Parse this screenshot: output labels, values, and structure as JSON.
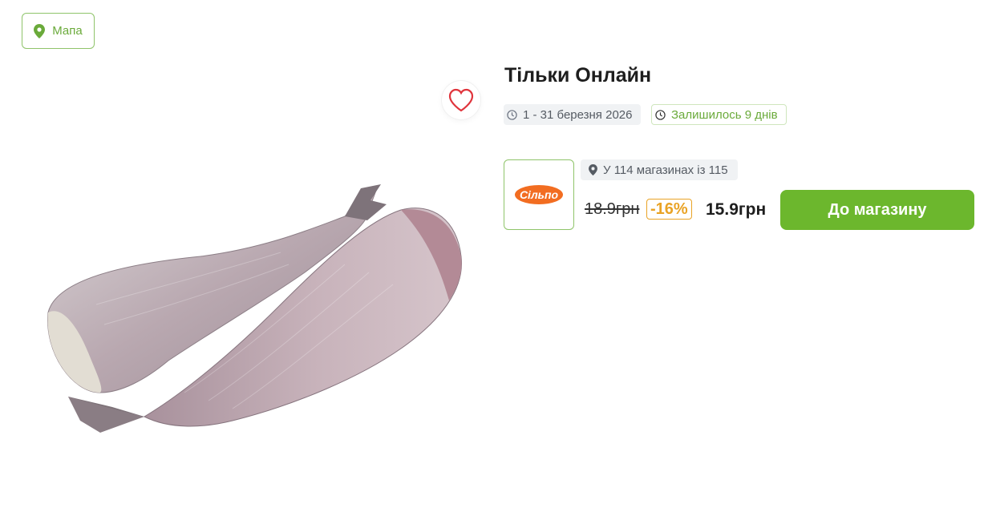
{
  "map_button": {
    "label": "Мапа",
    "icon": "map-pin-icon"
  },
  "offer": {
    "title": "Тільки Онлайн",
    "date_range": "1 - 31 березня 2026",
    "remaining": "Залишилось 9 днів"
  },
  "store": {
    "logo_text": "Сільпо",
    "availability": "У 114 магазинах із 115",
    "old_price": "18.9грн",
    "discount": "-16%",
    "new_price": "15.9грн",
    "button_label": "До магазину"
  },
  "colors": {
    "accent_green": "#6cb72d",
    "discount_orange": "#e9a326",
    "favorite_red": "#e0343c",
    "logo_orange": "#f26d21"
  }
}
